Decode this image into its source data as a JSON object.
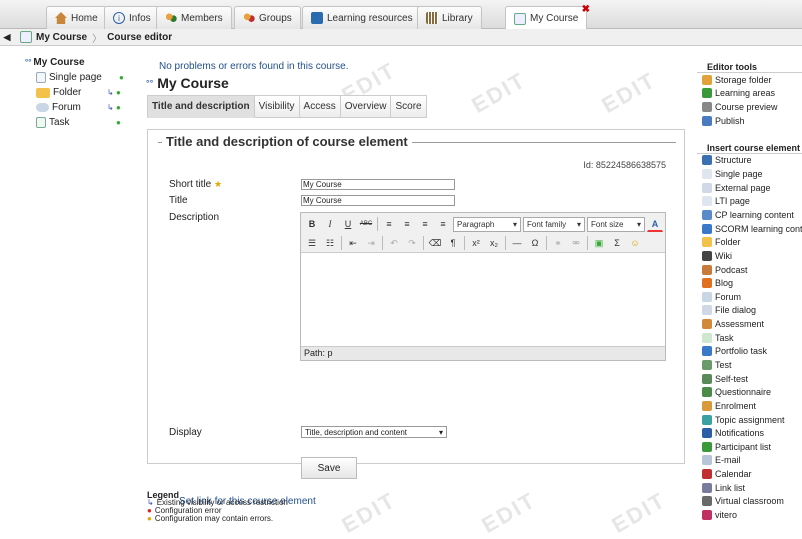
{
  "top_tabs": [
    {
      "label": "Home",
      "icon": "home-icon"
    },
    {
      "label": "Infos",
      "icon": "info-icon"
    },
    {
      "label": "Members",
      "icon": "members-icon"
    },
    {
      "label": "Groups",
      "icon": "groups-icon"
    },
    {
      "label": "Learning resources",
      "icon": "learning-resources-icon"
    },
    {
      "label": "Library",
      "icon": "library-icon"
    },
    {
      "label": "My Course",
      "icon": "course-icon",
      "active": true,
      "close": "✖"
    }
  ],
  "breadcrumb": {
    "course": "My Course",
    "current": "Course editor"
  },
  "leftnav": {
    "root": "My Course",
    "items": [
      {
        "label": "Single page",
        "icon": "single-page-icon"
      },
      {
        "label": "Folder",
        "icon": "folder-icon"
      },
      {
        "label": "Forum",
        "icon": "forum-icon"
      },
      {
        "label": "Task",
        "icon": "task-icon"
      }
    ]
  },
  "main": {
    "notice": "No problems or errors found in this course.",
    "course_title": "My Course",
    "tabs": [
      "Title and description",
      "Visibility",
      "Access",
      "Overview",
      "Score"
    ],
    "panel_title": "Title and description of course element",
    "id_line": "Id: 85224586638575",
    "fields": {
      "short_title_label": "Short title",
      "short_title_value": "My Course",
      "title_label": "Title",
      "title_value": "My Course",
      "description_label": "Description",
      "display_label": "Display",
      "display_value": "Title, description and content"
    },
    "editor": {
      "paragraph": "Paragraph",
      "font_family": "Font family",
      "font_size": "Font size",
      "path": "Path: p"
    },
    "save_label": "Save",
    "set_link": "Set link for this course element"
  },
  "legend": {
    "title": "Legend",
    "rows": [
      "Existing visibility or access restriction",
      "Configuration error",
      "Configuration may contain errors."
    ]
  },
  "sidebar": {
    "editor_tools_title": "Editor tools",
    "editor_tools": [
      {
        "label": "Storage folder",
        "icon": "storage-folder-icon"
      },
      {
        "label": "Learning areas",
        "icon": "learning-areas-icon"
      },
      {
        "label": "Course preview",
        "icon": "course-preview-icon"
      },
      {
        "label": "Publish",
        "icon": "publish-icon"
      }
    ],
    "insert_title": "Insert course element",
    "insert_items": [
      {
        "label": "Structure",
        "icon": "structure-icon"
      },
      {
        "label": "Single page",
        "icon": "single-page-icon"
      },
      {
        "label": "External page",
        "icon": "external-page-icon"
      },
      {
        "label": "LTI page",
        "icon": "lti-page-icon"
      },
      {
        "label": "CP learning content",
        "icon": "cp-content-icon"
      },
      {
        "label": "SCORM learning content",
        "icon": "scorm-icon"
      },
      {
        "label": "Folder",
        "icon": "folder-icon"
      },
      {
        "label": "Wiki",
        "icon": "wiki-icon"
      },
      {
        "label": "Podcast",
        "icon": "podcast-icon"
      },
      {
        "label": "Blog",
        "icon": "blog-icon"
      },
      {
        "label": "Forum",
        "icon": "forum-icon"
      },
      {
        "label": "File dialog",
        "icon": "file-dialog-icon"
      },
      {
        "label": "Assessment",
        "icon": "assessment-icon"
      },
      {
        "label": "Task",
        "icon": "task-icon"
      },
      {
        "label": "Portfolio task",
        "icon": "portfolio-task-icon"
      },
      {
        "label": "Test",
        "icon": "test-icon"
      },
      {
        "label": "Self-test",
        "icon": "self-test-icon"
      },
      {
        "label": "Questionnaire",
        "icon": "questionnaire-icon"
      },
      {
        "label": "Enrolment",
        "icon": "enrolment-icon"
      },
      {
        "label": "Topic assignment",
        "icon": "topic-assignment-icon"
      },
      {
        "label": "Notifications",
        "icon": "notifications-icon"
      },
      {
        "label": "Participant list",
        "icon": "participant-list-icon"
      },
      {
        "label": "E-mail",
        "icon": "email-icon"
      },
      {
        "label": "Calendar",
        "icon": "calendar-icon"
      },
      {
        "label": "Link list",
        "icon": "link-list-icon"
      },
      {
        "label": "Virtual classroom",
        "icon": "virtual-classroom-icon"
      },
      {
        "label": "vitero",
        "icon": "vitero-icon"
      }
    ]
  },
  "watermark": "EDIT"
}
